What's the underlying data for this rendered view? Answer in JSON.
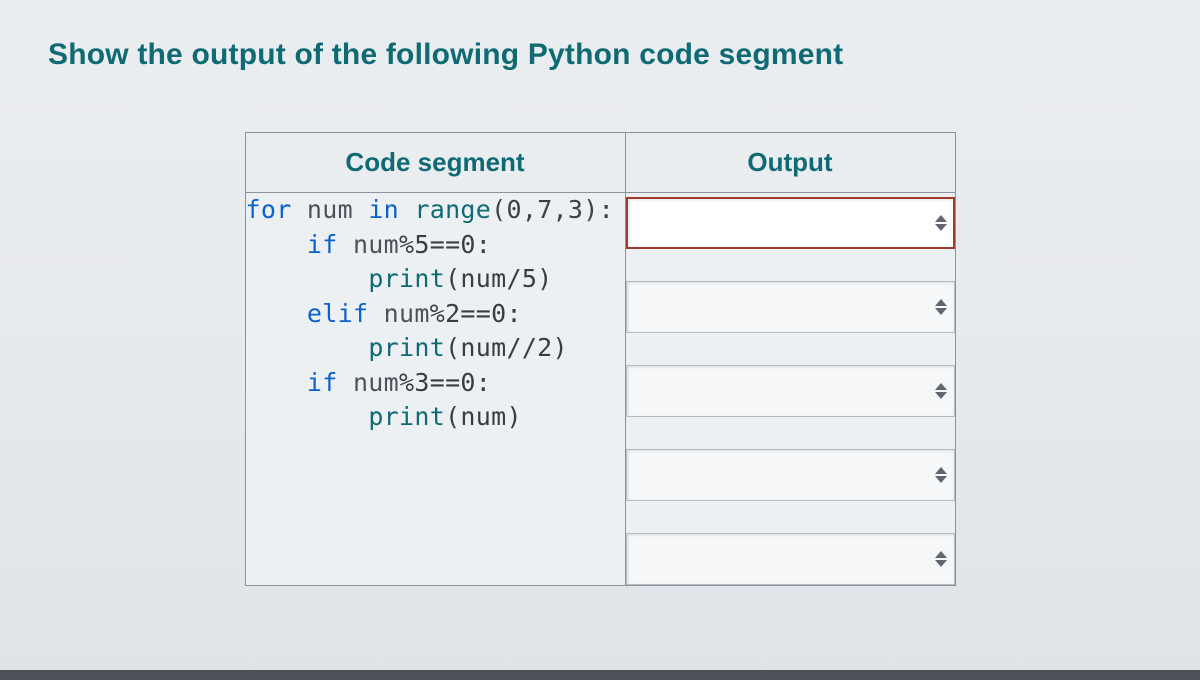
{
  "title": "Show the output of the following Python code segment",
  "table": {
    "header_code": "Code segment",
    "header_output": "Output"
  },
  "code": {
    "line1_for": "for",
    "line1_num": " num ",
    "line1_in": "in",
    "line1_range": " range",
    "line1_args": "(0,7,3)",
    "line1_colon": ":",
    "line2_if": "if",
    "line2_expr_a": " num",
    "line2_expr_b": "%5==0",
    "line2_colon": ":",
    "line3_print": "print",
    "line3_args": "(num/5)",
    "line4_elif": "elif",
    "line4_expr_a": " num",
    "line4_expr_b": "%2==0",
    "line4_colon": ":",
    "line5_print": "print",
    "line5_args": "(num//2)",
    "line6_if": "if",
    "line6_expr_a": " num",
    "line6_expr_b": "%3==0",
    "line6_colon": ":",
    "line7_print": "print",
    "line7_args": "(num)"
  },
  "outputs": [
    "",
    "",
    "",
    "",
    ""
  ]
}
